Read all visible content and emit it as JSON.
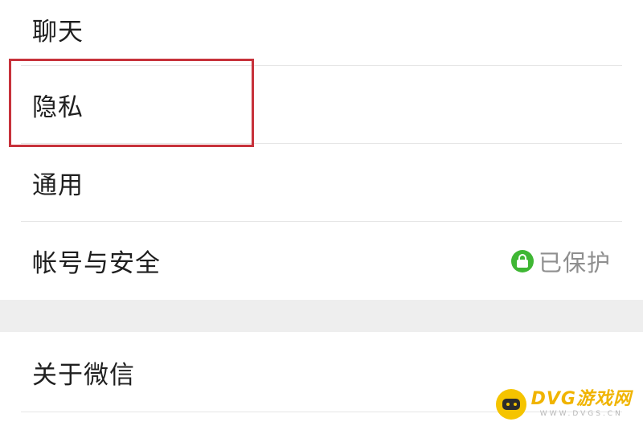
{
  "settings": {
    "group1": [
      {
        "label": "聊天"
      },
      {
        "label": "隐私"
      },
      {
        "label": "通用"
      },
      {
        "label": "帐号与安全",
        "status": "已保护",
        "status_icon": "lock-icon"
      }
    ],
    "group2": [
      {
        "label": "关于微信"
      }
    ]
  },
  "colors": {
    "highlight": "#c7323b",
    "lock_badge": "#3fb734",
    "separator": "#eeeeee"
  },
  "watermark": {
    "title": "DVG游戏网",
    "subtitle": "WWW.DVGS.CN"
  }
}
